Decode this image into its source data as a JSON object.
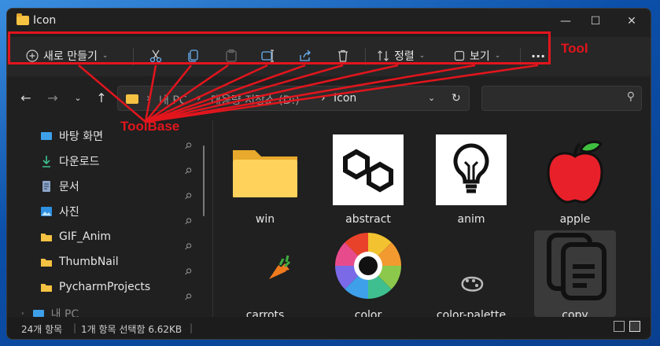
{
  "window": {
    "title": "Icon"
  },
  "toolbar": {
    "new_label": "새로 만들기",
    "sort_label": "정렬",
    "view_label": "보기",
    "more_label": "···"
  },
  "annotations": {
    "tool": "Tool",
    "toolbase": "ToolBase",
    "accent": "#e2151d"
  },
  "breadcrumb": {
    "pc": "내 PC",
    "drive": "대용량 저장소 (D:)",
    "folder": "Icon"
  },
  "sidebar": {
    "items": [
      {
        "label": "바탕 화면",
        "icon": "desktop-icon"
      },
      {
        "label": "다운로드",
        "icon": "download-icon"
      },
      {
        "label": "문서",
        "icon": "document-icon"
      },
      {
        "label": "사진",
        "icon": "pictures-icon"
      },
      {
        "label": "GIF_Anim",
        "icon": "folder-icon"
      },
      {
        "label": "ThumbNail",
        "icon": "folder-icon"
      },
      {
        "label": "PycharmProjects",
        "icon": "folder-icon"
      },
      {
        "label": "내 PC",
        "icon": "pc-icon"
      }
    ]
  },
  "files": [
    {
      "name": "win",
      "icon": "folder-icon"
    },
    {
      "name": "abstract",
      "icon": "abstract-icon"
    },
    {
      "name": "anim",
      "icon": "lightbulb-icon"
    },
    {
      "name": "apple",
      "icon": "apple-icon"
    },
    {
      "name": "carrots",
      "icon": "carrot-icon"
    },
    {
      "name": "color",
      "icon": "color-wheel-icon"
    },
    {
      "name": "color-palette",
      "icon": "palette-icon"
    },
    {
      "name": "copy",
      "icon": "copy-icon"
    }
  ],
  "status": {
    "count": "24개 항목",
    "selected": "1개 항목 선택함 6.62KB"
  }
}
